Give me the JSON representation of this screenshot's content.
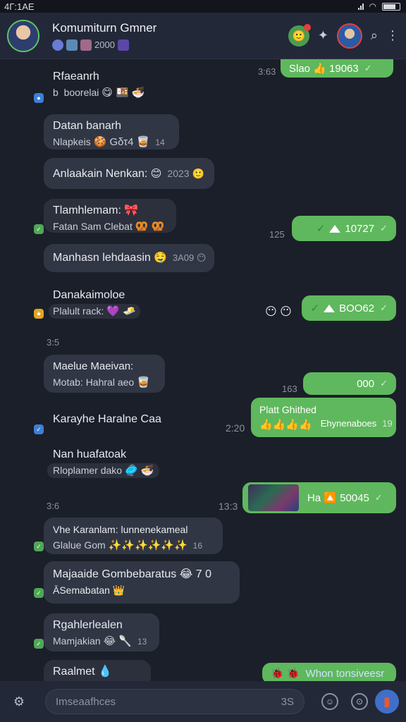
{
  "status_bar": {
    "time": "4Γ:1ΑΕ"
  },
  "header": {
    "title": "Komumiturn Gmner",
    "sub_count": "2000"
  },
  "messages_in": [
    {
      "name": "Rfaeanrh",
      "line2": "b  boorelai",
      "emoji": "😋 🍱 🍜",
      "stamp": ""
    },
    {
      "name": "Datan banarh",
      "line2": "Nlapkeis",
      "emoji": "🍪 Gδτ4 🥃",
      "stamp": "14"
    },
    {
      "name": "Anlaakain Nenkan:",
      "line2": "",
      "emoji": "😊",
      "stamp": "2023 🙂"
    },
    {
      "name": "Tlamhlemam: 🎀",
      "line2": "Fatan Sam Clebat",
      "emoji": "🥨 🥨",
      "stamp": ""
    },
    {
      "name": "Manhasn lehdaasin",
      "line2": "",
      "emoji": "🤤",
      "stamp": "3Α09 😶"
    },
    {
      "name": "Danakaimoloe",
      "line2": "Plalult rack:",
      "emoji": "💜 🧈",
      "stamp": ""
    },
    {
      "name": "Maelue Maeivan:",
      "line2": "Motab: Hahral aeo",
      "emoji": "🥃",
      "stamp": ""
    },
    {
      "name": "Karayhe Haralne Caa",
      "line2": "",
      "emoji": "",
      "stamp": ""
    },
    {
      "name": "Nan huafatoak",
      "line2": "Rloplamer dako",
      "emoji": "🥏 🍜",
      "stamp": ""
    },
    {
      "name": "Vhe Karanlam: lunnenekameal",
      "line2": "Glalue Gom",
      "emoji": "✨✨✨✨✨✨",
      "stamp": "16"
    },
    {
      "name": "Majaaide Gombebaratus 😂 7 0",
      "line2": "ĀSemabatan 👑",
      "emoji": "",
      "stamp": ""
    },
    {
      "name": "Rgahlerlealen",
      "line2": "Mamjakian",
      "emoji": "😂 🥄",
      "stamp": "13"
    },
    {
      "name": "Raalmet 💧",
      "line2": "",
      "emoji": "",
      "stamp": ""
    }
  ],
  "messages_out": [
    {
      "time": "3:63",
      "text": "Slao 👍 19063"
    },
    {
      "time": "125",
      "text": "10727"
    },
    {
      "time": "",
      "text": "BOO62"
    },
    {
      "time": "163",
      "text": "000"
    },
    {
      "time": "2:20",
      "title": "Platt Ghithed",
      "text": "Ehynenaboes",
      "emoji": "👍👍👍👍",
      "stamp": "19"
    },
    {
      "time": "13:3",
      "text": "Ha 🔼 50045"
    },
    {
      "time": "",
      "text": "Whon tonsiveesr"
    }
  ],
  "day_stamps": [
    "3:5",
    "3:6"
  ],
  "composer": {
    "placeholder": "Imseaafhces",
    "counter": "3S"
  },
  "colors": {
    "accent": "#5fb85d",
    "background": "#1b1f29",
    "bubble_in": "#313644"
  }
}
